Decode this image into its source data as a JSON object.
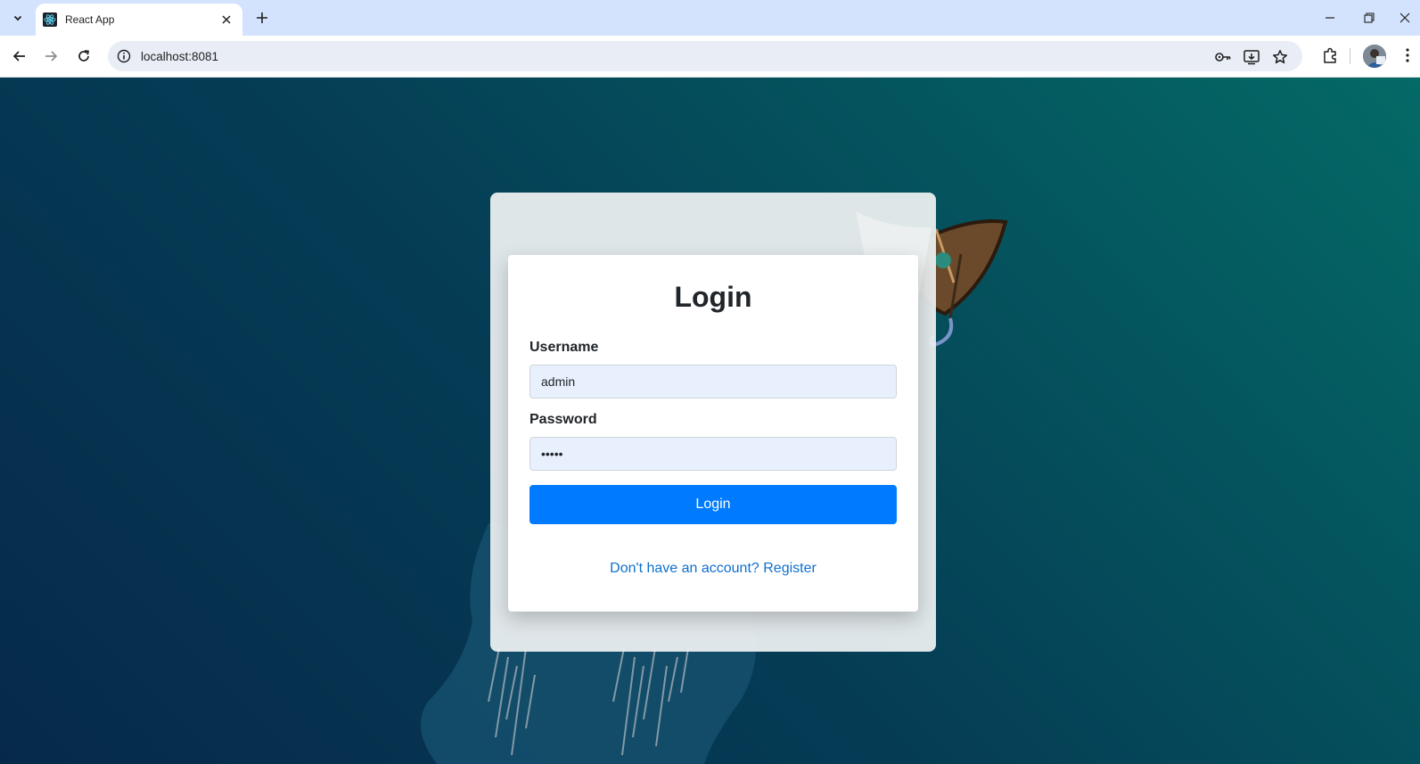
{
  "browser": {
    "tab_title": "React App",
    "url": "localhost:8081"
  },
  "icons": {
    "tab_search": "chevron-down-icon",
    "favicon": "react-logo-icon",
    "tab_close": "close-icon",
    "new_tab": "plus-icon",
    "minimize": "minimize-icon",
    "restore": "restore-icon",
    "close": "close-icon",
    "back": "back-arrow-icon",
    "forward": "forward-arrow-icon",
    "reload": "reload-icon",
    "site_info": "info-icon",
    "password_manager": "key-icon",
    "install_app": "install-icon",
    "bookmark": "star-icon",
    "extensions": "puzzle-icon",
    "profile": "avatar-icon",
    "menu": "kebab-menu-icon"
  },
  "login": {
    "title": "Login",
    "username_label": "Username",
    "username_value": "admin",
    "password_label": "Password",
    "password_value": "•••••",
    "submit_label": "Login",
    "register_text": "Don't have an account? Register"
  },
  "colors": {
    "primary_button": "#007bff",
    "link": "#0f6fce",
    "input_autofill": "#e8f0fe",
    "background_dark": "#06294a",
    "background_teal": "#046a66"
  }
}
